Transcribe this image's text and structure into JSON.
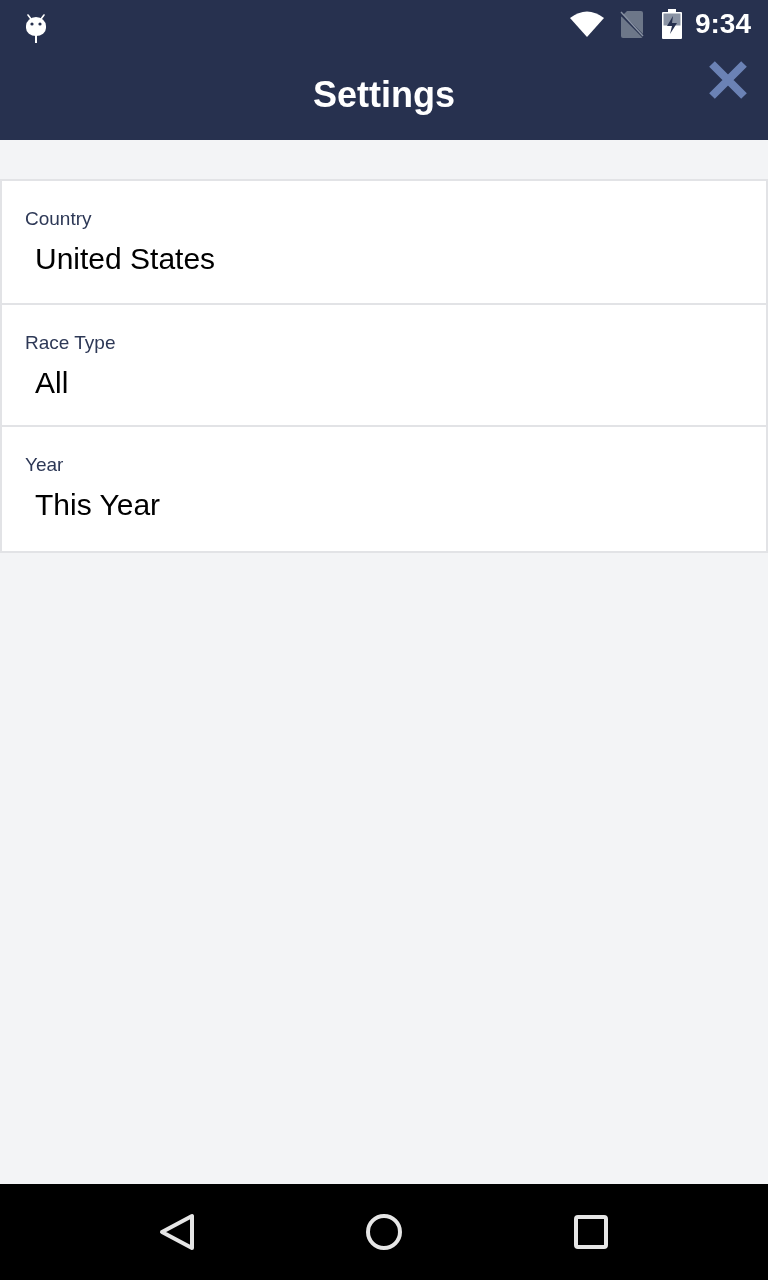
{
  "status_bar": {
    "time": "9:34"
  },
  "header": {
    "title": "Settings"
  },
  "settings": [
    {
      "label": "Country",
      "value": "United States"
    },
    {
      "label": "Race Type",
      "value": "All"
    },
    {
      "label": "Year",
      "value": "This Year"
    }
  ]
}
